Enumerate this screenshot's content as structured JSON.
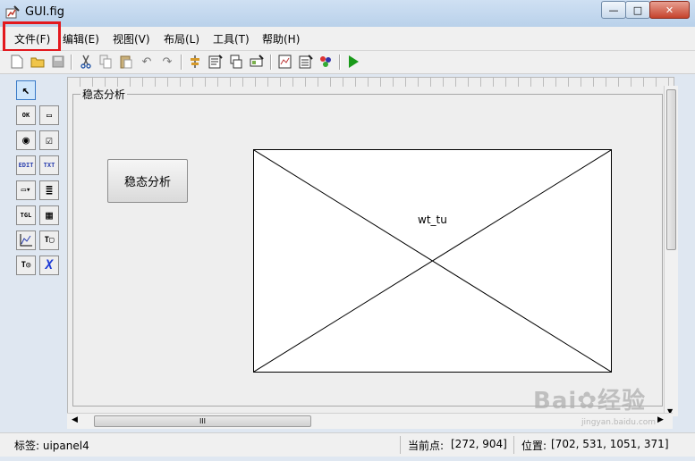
{
  "window": {
    "title": "GUI.fig",
    "minimize_glyph": "—",
    "maximize_glyph": "□",
    "close_glyph": "✕"
  },
  "menu": [
    {
      "label": "文件(F)"
    },
    {
      "label": "编辑(E)"
    },
    {
      "label": "视图(V)"
    },
    {
      "label": "布局(L)"
    },
    {
      "label": "工具(T)"
    },
    {
      "label": "帮助(H)"
    }
  ],
  "toolbar": {
    "icons": [
      "new-file-icon",
      "open-folder-icon",
      "save-icon",
      "cut-icon",
      "copy-icon",
      "paste-icon",
      "undo-icon",
      "redo-icon",
      "align-objects-icon",
      "menu-editor-icon",
      "tab-order-editor-icon",
      "toolbar-editor-icon",
      "mfile-editor-icon",
      "property-inspector-icon",
      "object-browser-icon",
      "run-figure-icon"
    ]
  },
  "palette": {
    "items": [
      {
        "name": "select-tool-icon",
        "glyph": "↖"
      },
      {
        "name": "push-button-tool-icon",
        "glyph": "OK"
      },
      {
        "name": "slider-tool-icon",
        "glyph": "▭"
      },
      {
        "name": "radio-button-tool-icon",
        "glyph": "◉"
      },
      {
        "name": "checkbox-tool-icon",
        "glyph": "☑"
      },
      {
        "name": "edit-text-tool-icon",
        "glyph": "EDIT"
      },
      {
        "name": "static-text-tool-icon",
        "glyph": "TXT"
      },
      {
        "name": "popup-menu-tool-icon",
        "glyph": "▭▾"
      },
      {
        "name": "listbox-tool-icon",
        "glyph": "≣"
      },
      {
        "name": "toggle-button-tool-icon",
        "glyph": "TGL"
      },
      {
        "name": "table-tool-icon",
        "glyph": "▦"
      },
      {
        "name": "axes-tool-icon",
        "glyph": "📈"
      },
      {
        "name": "panel-tool-icon",
        "glyph": "T▢"
      },
      {
        "name": "button-group-tool-icon",
        "glyph": "T◎"
      },
      {
        "name": "activex-tool-icon",
        "glyph": "X"
      }
    ]
  },
  "canvas": {
    "panel_title": "稳态分析",
    "button_label": "稳态分析",
    "axes_tag": "wt_tu"
  },
  "status": {
    "tag_label": "标签: uipanel4",
    "current_point_label": "当前点:",
    "current_point_value": "[272, 904]",
    "position_label": "位置:",
    "position_value": "[702, 531, 1051, 371]"
  },
  "watermark": {
    "brand": "Bai✿经验",
    "sub": "jingyan.baidu.com"
  },
  "colors": {
    "highlight": "#e3181d",
    "run": "#1a9a1a"
  }
}
